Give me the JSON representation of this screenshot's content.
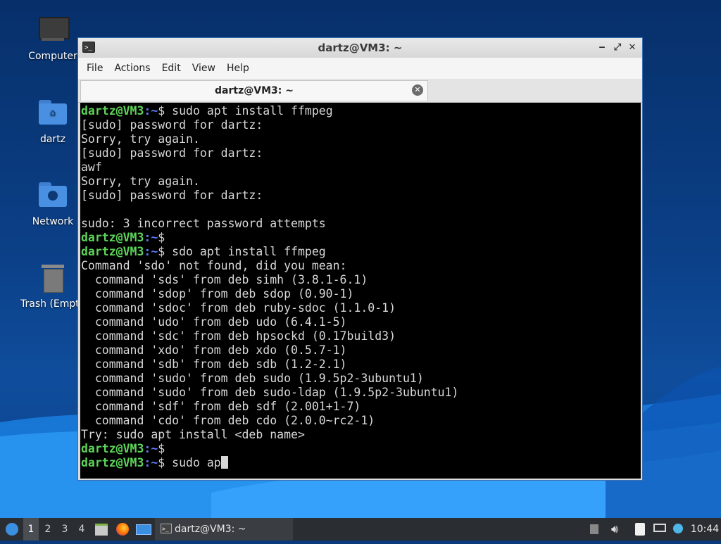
{
  "desktop": {
    "icons": [
      {
        "label": "Computer",
        "icon": "computer-icon"
      },
      {
        "label": "dartz",
        "icon": "home-folder-icon"
      },
      {
        "label": "Network",
        "icon": "network-folder-icon"
      },
      {
        "label": "Trash (Empty)",
        "icon": "trash-icon"
      }
    ]
  },
  "window": {
    "title": "dartz@VM3: ~",
    "menu": [
      "File",
      "Actions",
      "Edit",
      "View",
      "Help"
    ],
    "tab_title": "dartz@VM3: ~",
    "controls": {
      "minimize": "‒",
      "maximize": "⤢",
      "close": "✕"
    }
  },
  "terminal": {
    "prompt_user": "dartz@VM3",
    "prompt_path": ":~",
    "prompt_symbol": "$",
    "lines": [
      {
        "type": "prompt",
        "cmd": " sudo apt install ffmpeg"
      },
      {
        "type": "out",
        "text": "[sudo] password for dartz:"
      },
      {
        "type": "out",
        "text": "Sorry, try again."
      },
      {
        "type": "out",
        "text": "[sudo] password for dartz:"
      },
      {
        "type": "out",
        "text": "awf"
      },
      {
        "type": "out",
        "text": "Sorry, try again."
      },
      {
        "type": "out",
        "text": "[sudo] password for dartz:"
      },
      {
        "type": "out",
        "text": ""
      },
      {
        "type": "out",
        "text": "sudo: 3 incorrect password attempts"
      },
      {
        "type": "prompt",
        "cmd": ""
      },
      {
        "type": "prompt",
        "cmd": " sdo apt install ffmpeg"
      },
      {
        "type": "out",
        "text": "Command 'sdo' not found, did you mean:"
      },
      {
        "type": "out",
        "text": "  command 'sds' from deb simh (3.8.1-6.1)"
      },
      {
        "type": "out",
        "text": "  command 'sdop' from deb sdop (0.90-1)"
      },
      {
        "type": "out",
        "text": "  command 'sdoc' from deb ruby-sdoc (1.1.0-1)"
      },
      {
        "type": "out",
        "text": "  command 'udo' from deb udo (6.4.1-5)"
      },
      {
        "type": "out",
        "text": "  command 'sdc' from deb hpsockd (0.17build3)"
      },
      {
        "type": "out",
        "text": "  command 'xdo' from deb xdo (0.5.7-1)"
      },
      {
        "type": "out",
        "text": "  command 'sdb' from deb sdb (1.2-2.1)"
      },
      {
        "type": "out",
        "text": "  command 'sudo' from deb sudo (1.9.5p2-3ubuntu1)"
      },
      {
        "type": "out",
        "text": "  command 'sudo' from deb sudo-ldap (1.9.5p2-3ubuntu1)"
      },
      {
        "type": "out",
        "text": "  command 'sdf' from deb sdf (2.001+1-7)"
      },
      {
        "type": "out",
        "text": "  command 'cdo' from deb cdo (2.0.0~rc2-1)"
      },
      {
        "type": "out",
        "text": "Try: sudo apt install <deb name>"
      },
      {
        "type": "prompt",
        "cmd": ""
      },
      {
        "type": "prompt",
        "cmd": " sudo ap",
        "cursor": true
      }
    ]
  },
  "taskbar": {
    "workspaces": [
      "1",
      "2",
      "3",
      "4"
    ],
    "active_workspace": "1",
    "task_label": "dartz@VM3: ~",
    "clock": "10:44",
    "launchers": [
      "start-menu-icon",
      "file-manager-icon",
      "firefox-icon",
      "show-desktop-icon"
    ],
    "tray": [
      "notification-icon",
      "volume-icon",
      "clipboard-icon",
      "network-icon",
      "update-icon"
    ]
  }
}
